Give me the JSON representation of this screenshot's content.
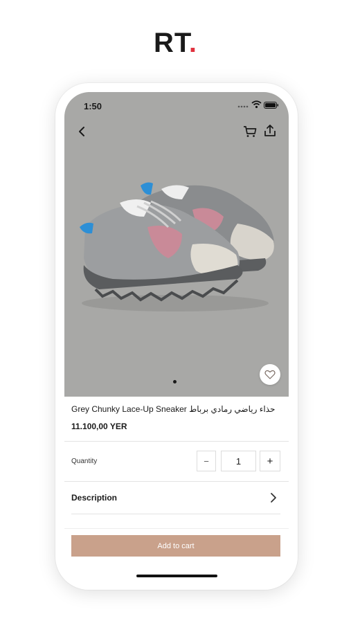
{
  "brand": {
    "name": "RT",
    "dot": ".",
    "dot_color": "#e0313e"
  },
  "status_bar": {
    "time": "1:50"
  },
  "nav": {
    "back_icon": "chevron-left-icon",
    "cart_icon": "cart-icon",
    "share_icon": "share-icon"
  },
  "product": {
    "title": "Grey Chunky Lace-Up Sneaker حذاء رياضي رمادي برباط",
    "price": "11.100,00 YER",
    "image_bg": "#a8a8a6",
    "favorite_icon": "heart-icon",
    "image_page_count": 1
  },
  "quantity": {
    "label": "Quantity",
    "value": "1",
    "minus": "−",
    "plus": "+"
  },
  "description": {
    "label": "Description"
  },
  "cta": {
    "label": "Add to cart",
    "color": "#c9a18b"
  }
}
